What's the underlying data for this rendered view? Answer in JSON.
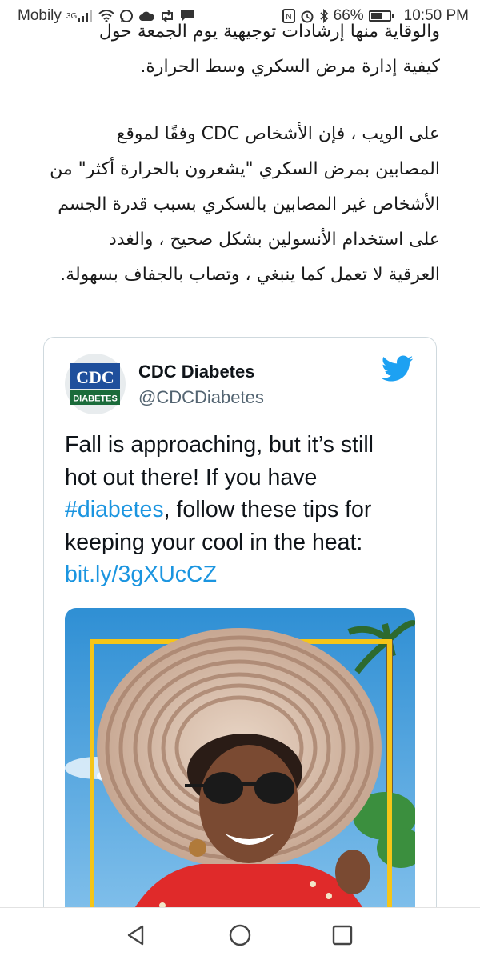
{
  "statusbar": {
    "carrier": "Mobily",
    "network": "3G",
    "battery": "66%",
    "battery_level": 0.66,
    "time": "10:50 PM"
  },
  "article": {
    "lines_para1": [
      "والوقاية منها إرشادات توجيهية يوم الجمعة حول",
      "كيفية إدارة مرض السكري وسط الحرارة."
    ],
    "lines_para2": [
      "على الويب ، فإن الأشخاص CDC وفقًا لموقع",
      "المصابين بمرض السكري \"يشعرون بالحرارة أكثر\" من",
      "الأشخاص غير المصابين بالسكري بسبب قدرة الجسم",
      "على استخدام الأنسولين بشكل صحيح ، والغدد",
      "العرقية لا تعمل كما ينبغي ، وتصاب بالجفاف بسهولة."
    ]
  },
  "tweet": {
    "avatar_top": "CDC",
    "avatar_bottom": "DIABETES",
    "display_name": "CDC Diabetes",
    "handle": "@CDCDiabetes",
    "text_lines": [
      "Fall is approaching, but it’s still",
      "hot out there! If you have"
    ],
    "hashtag": "#diabetes",
    "text_after_hashtag": ", follow these tips for",
    "text_line4": "keeping your cool in the heat:",
    "link": "bit.ly/3gXUcCZ",
    "colors": {
      "link": "#1b95e0",
      "twitter_blue": "#1da1f2",
      "frame_yellow": "#f5c518"
    }
  },
  "navbar": {
    "back_icon": "back-triangle-icon",
    "home_icon": "home-circle-icon",
    "recents_icon": "recents-square-icon"
  }
}
